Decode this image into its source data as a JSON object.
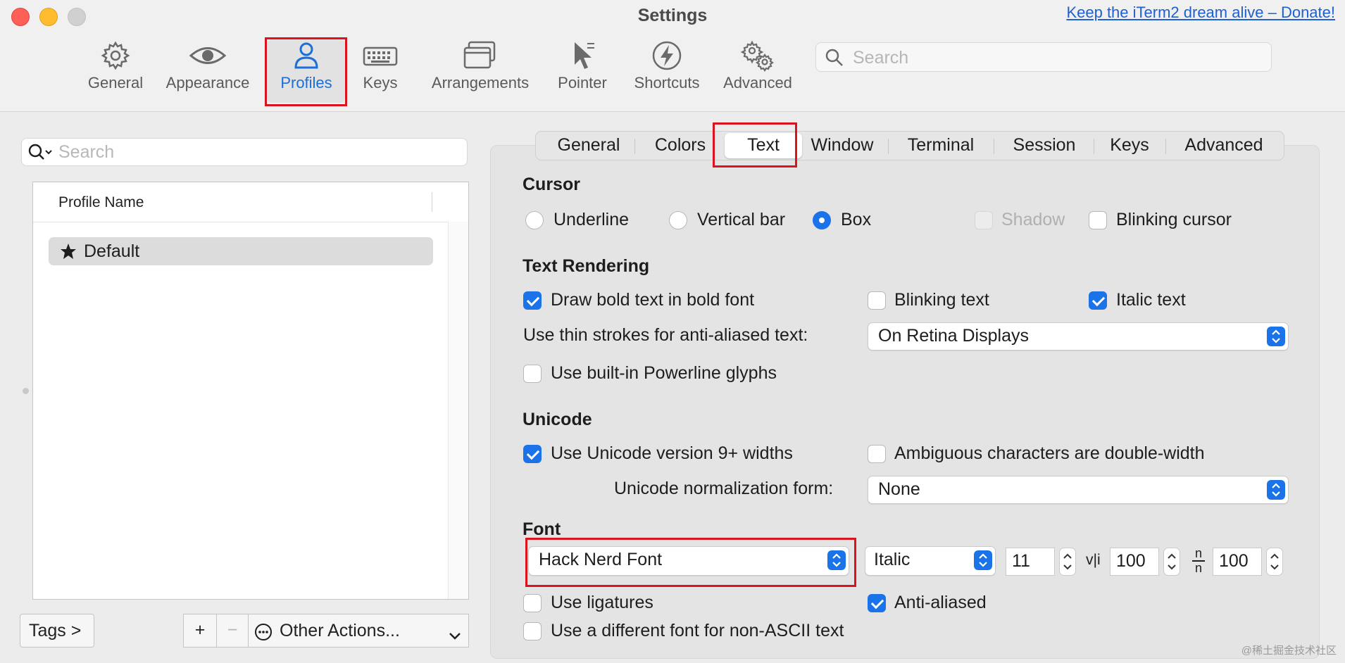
{
  "window": {
    "title": "Settings",
    "donate_link": "Keep the iTerm2 dream alive – Donate!",
    "traffic_colors": [
      "#fe5f57",
      "#febc2e",
      "#d0d0d0"
    ]
  },
  "toolbar": {
    "items": [
      {
        "label": "General",
        "icon": "gear-icon"
      },
      {
        "label": "Appearance",
        "icon": "eye-icon"
      },
      {
        "label": "Profiles",
        "icon": "person-icon",
        "selected": true
      },
      {
        "label": "Keys",
        "icon": "keyboard-icon"
      },
      {
        "label": "Arrangements",
        "icon": "windows-icon"
      },
      {
        "label": "Pointer",
        "icon": "cursor-icon"
      },
      {
        "label": "Shortcuts",
        "icon": "lightning-icon"
      },
      {
        "label": "Advanced",
        "icon": "gears-icon"
      }
    ],
    "search_placeholder": "Search"
  },
  "profiles_panel": {
    "search_placeholder": "Search",
    "column_header": "Profile Name",
    "profiles": [
      {
        "name": "Default",
        "default": true
      }
    ],
    "tags_button": "Tags >",
    "add_button": "+",
    "remove_button": "−",
    "other_actions": "Other Actions..."
  },
  "tabs": [
    "General",
    "Colors",
    "Text",
    "Window",
    "Terminal",
    "Session",
    "Keys",
    "Advanced"
  ],
  "selected_tab": "Text",
  "cursor": {
    "heading": "Cursor",
    "underline": "Underline",
    "vertical_bar": "Vertical bar",
    "box": "Box",
    "selected": "Box",
    "shadow": "Shadow",
    "blinking_cursor": "Blinking cursor",
    "blinking_checked": false
  },
  "text_rendering": {
    "heading": "Text Rendering",
    "bold_font": "Draw bold text in bold font",
    "bold_checked": true,
    "blinking_text": "Blinking text",
    "blinking_checked": false,
    "italic_text": "Italic text",
    "italic_checked": true,
    "thin_strokes_label": "Use thin strokes for anti-aliased text:",
    "thin_strokes_value": "On Retina Displays",
    "powerline": "Use built-in Powerline glyphs",
    "powerline_checked": false
  },
  "unicode": {
    "heading": "Unicode",
    "widths": "Use Unicode version 9+ widths",
    "widths_checked": true,
    "ambiguous": "Ambiguous characters are double-width",
    "ambiguous_checked": false,
    "normalization_label": "Unicode normalization form:",
    "normalization_value": "None"
  },
  "font": {
    "heading": "Font",
    "family": "Hack Nerd Font",
    "style": "Italic",
    "size": "11",
    "h_spacing_symbol": "v|i",
    "h_spacing": "100",
    "v_spacing_symbol_top": "n",
    "v_spacing_symbol_bottom": "n",
    "v_spacing": "100",
    "ligatures": "Use ligatures",
    "ligatures_checked": false,
    "anti_aliased": "Anti-aliased",
    "anti_aliased_checked": true,
    "non_ascii": "Use a different font for non-ASCII text",
    "non_ascii_checked": false
  },
  "watermark": "@稀土掘金技术社区",
  "colors": {
    "accent": "#1a73e8",
    "highlight_box": "#d9141e"
  }
}
